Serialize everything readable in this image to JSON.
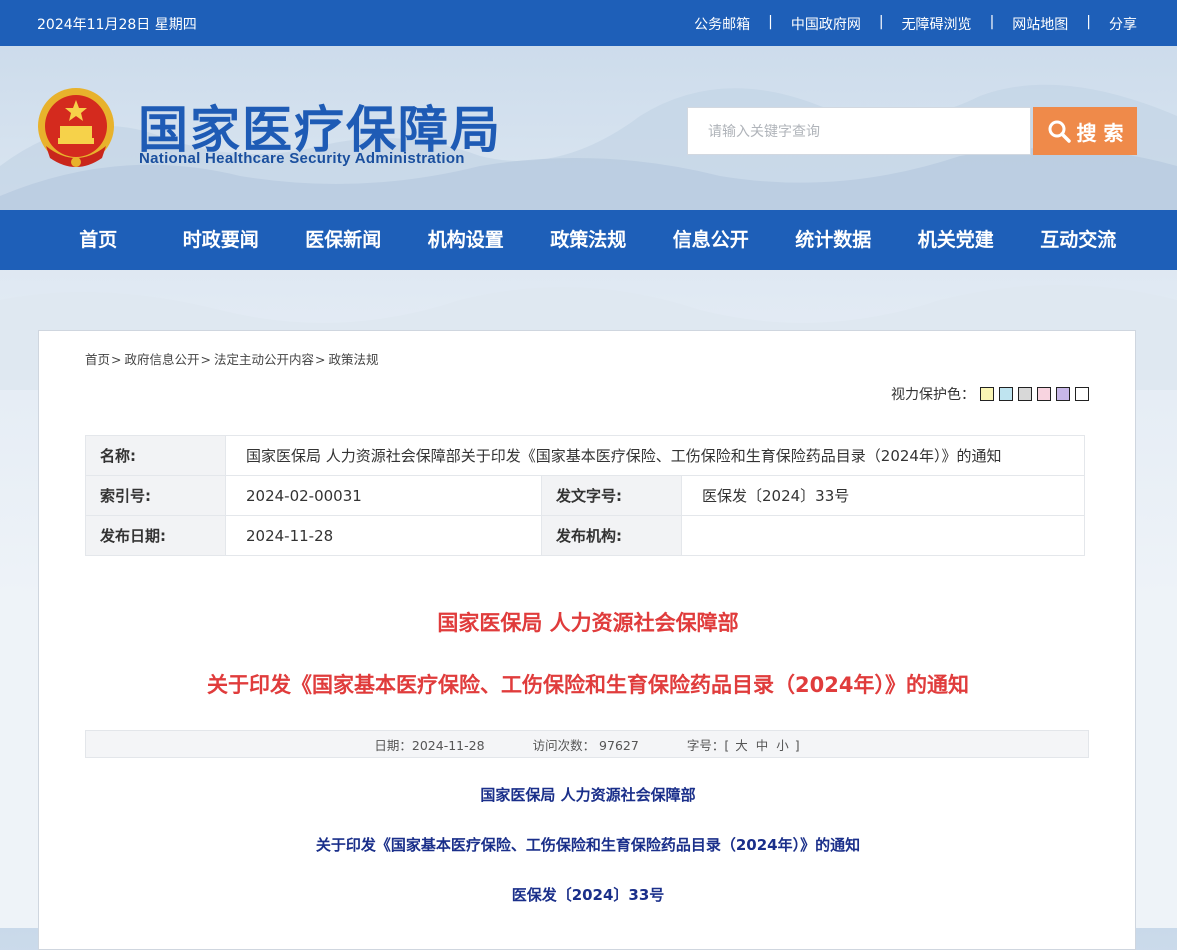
{
  "topbar": {
    "date": "2024年11月28日 星期四",
    "links": [
      "公务邮箱",
      "中国政府网",
      "无障碍浏览",
      "网站地图",
      "分享"
    ],
    "separator": "|"
  },
  "header": {
    "title": "国家医疗保障局",
    "subtitle": "National Healthcare Security Administration",
    "search_placeholder": "请输入关键字查询",
    "search_button": "搜 索"
  },
  "nav": [
    "首页",
    "时政要闻",
    "医保新闻",
    "机构设置",
    "政策法规",
    "信息公开",
    "统计数据",
    "机关党建",
    "互动交流"
  ],
  "breadcrumb": [
    "首页",
    "政府信息公开",
    "法定主动公开内容",
    "政策法规"
  ],
  "breadcrumb_arrow": ">",
  "eye_protect": {
    "label": "视力保护色：",
    "swatches": [
      "#faf5b4",
      "#bfe4f0",
      "#d8d8d8",
      "#f8d4e0",
      "#c8b8e8",
      "#ffffff"
    ]
  },
  "meta": {
    "name_label": "名称:",
    "name_value": "国家医保局 人力资源社会保障部关于印发《国家基本医疗保险、工伤保险和生育保险药品目录（2024年）》的通知",
    "index_label": "索引号:",
    "index_value": "2024-02-00031",
    "docno_label": "发文字号:",
    "docno_value": "医保发〔2024〕33号",
    "date_label": "发布日期:",
    "date_value": "2024-11-28",
    "org_label": "发布机构:",
    "org_value": ""
  },
  "doc": {
    "heading1": "国家医保局 人力资源社会保障部",
    "heading2": "关于印发《国家基本医疗保险、工伤保险和生育保险药品目录（2024年）》的通知",
    "info_date": "日期：2024-11-28",
    "info_visits": "访问次数： 97627",
    "info_size_label": "字号：[",
    "size_large": "大",
    "size_medium": "中",
    "size_small": "小",
    "info_size_end": "]",
    "body_line1": "国家医保局 人力资源社会保障部",
    "body_line2": "关于印发《国家基本医疗保险、工伤保险和生育保险药品目录（2024年）》的通知",
    "body_line3": "医保发〔2024〕33号"
  },
  "colors": {
    "primary_blue": "#1e5fb8",
    "search_orange": "#ef8a4a",
    "headline_red": "#e03c3c",
    "body_navy": "#1a2f8a"
  }
}
